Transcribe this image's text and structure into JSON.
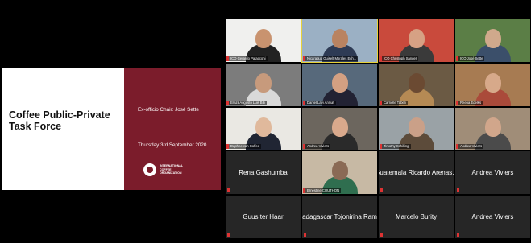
{
  "slide": {
    "title": "Coffee Public-Private Task Force",
    "chair": "Ex-officio Chair: José Sette",
    "date": "Thursday 3rd September 2020",
    "logo_text": "INTERNATIONAL COFFEE ORGANIZATION"
  },
  "participants": [
    {
      "name": "ICO Gerardo Patacconi",
      "bg": "#f0f0ee",
      "skin": "#c9936f",
      "shirt": "#222",
      "active": false
    },
    {
      "name": "Nicaragua Guiselt Morales Ech...",
      "bg": "#9bb0c4",
      "skin": "#b98361",
      "shirt": "#2e3b55",
      "active": true
    },
    {
      "name": "ICO Christoph Sanger",
      "bg": "#c94a3c",
      "skin": "#d6a184",
      "shirt": "#3a3a3a",
      "active": false
    },
    {
      "name": "ICO José Sette",
      "bg": "#5b7e46",
      "skin": "#d0a98c",
      "shirt": "#3b4f6a",
      "active": false
    },
    {
      "name": "Brazil Augusto Luis Billi",
      "bg": "#7c7c7c",
      "skin": "#c79a7c",
      "shirt": "#d9d9d9",
      "active": false
    },
    {
      "name": "Daniel Lavi Annuit",
      "bg": "#57697b",
      "skin": "#d3a082",
      "shirt": "#223",
      "active": false
    },
    {
      "name": "Carnelle Tabeli",
      "bg": "#6b5a44",
      "skin": "#6b4a32",
      "shirt": "#b58a54",
      "active": false
    },
    {
      "name": "Reena Edelks",
      "bg": "#a77b52",
      "skin": "#d7a98a",
      "shirt": "#aa4a3a",
      "active": false
    },
    {
      "name": "Daphne van Coffee",
      "bg": "#eae8e3",
      "skin": "#e0b99c",
      "shirt": "#202533",
      "active": false
    },
    {
      "name": "Andrea Viviers",
      "bg": "#6c665e",
      "skin": "#d9a98c",
      "shirt": "#2a2a2a",
      "active": false
    },
    {
      "name": "Timothy Schilling",
      "bg": "#9aa2a6",
      "skin": "#caa088",
      "shirt": "#5c4b3a",
      "active": false
    },
    {
      "name": "Andrea Viviers",
      "bg": "#a08d78",
      "skin": "#d1a68b",
      "shirt": "#4b4b4b",
      "active": false
    },
    {
      "name": "Rena Gashumba",
      "textOnly": true
    },
    {
      "name": "Ernestine COUTHON",
      "bg": "#c7b9a4",
      "skin": "#8a6a55",
      "shirt": "#2f6e4f",
      "active": false
    },
    {
      "name": "Guatemala Ricardo Arenas...",
      "textOnly": true
    },
    {
      "name": "Andrea Viviers",
      "textOnly": true
    },
    {
      "name": "Guus ter Haar",
      "textOnly": true
    },
    {
      "name": "Madagascar Tojonirina Ram...",
      "textOnly": true
    },
    {
      "name": "Marcelo Burity",
      "textOnly": true
    },
    {
      "name": "Andrea Viviers",
      "textOnly": true
    }
  ]
}
